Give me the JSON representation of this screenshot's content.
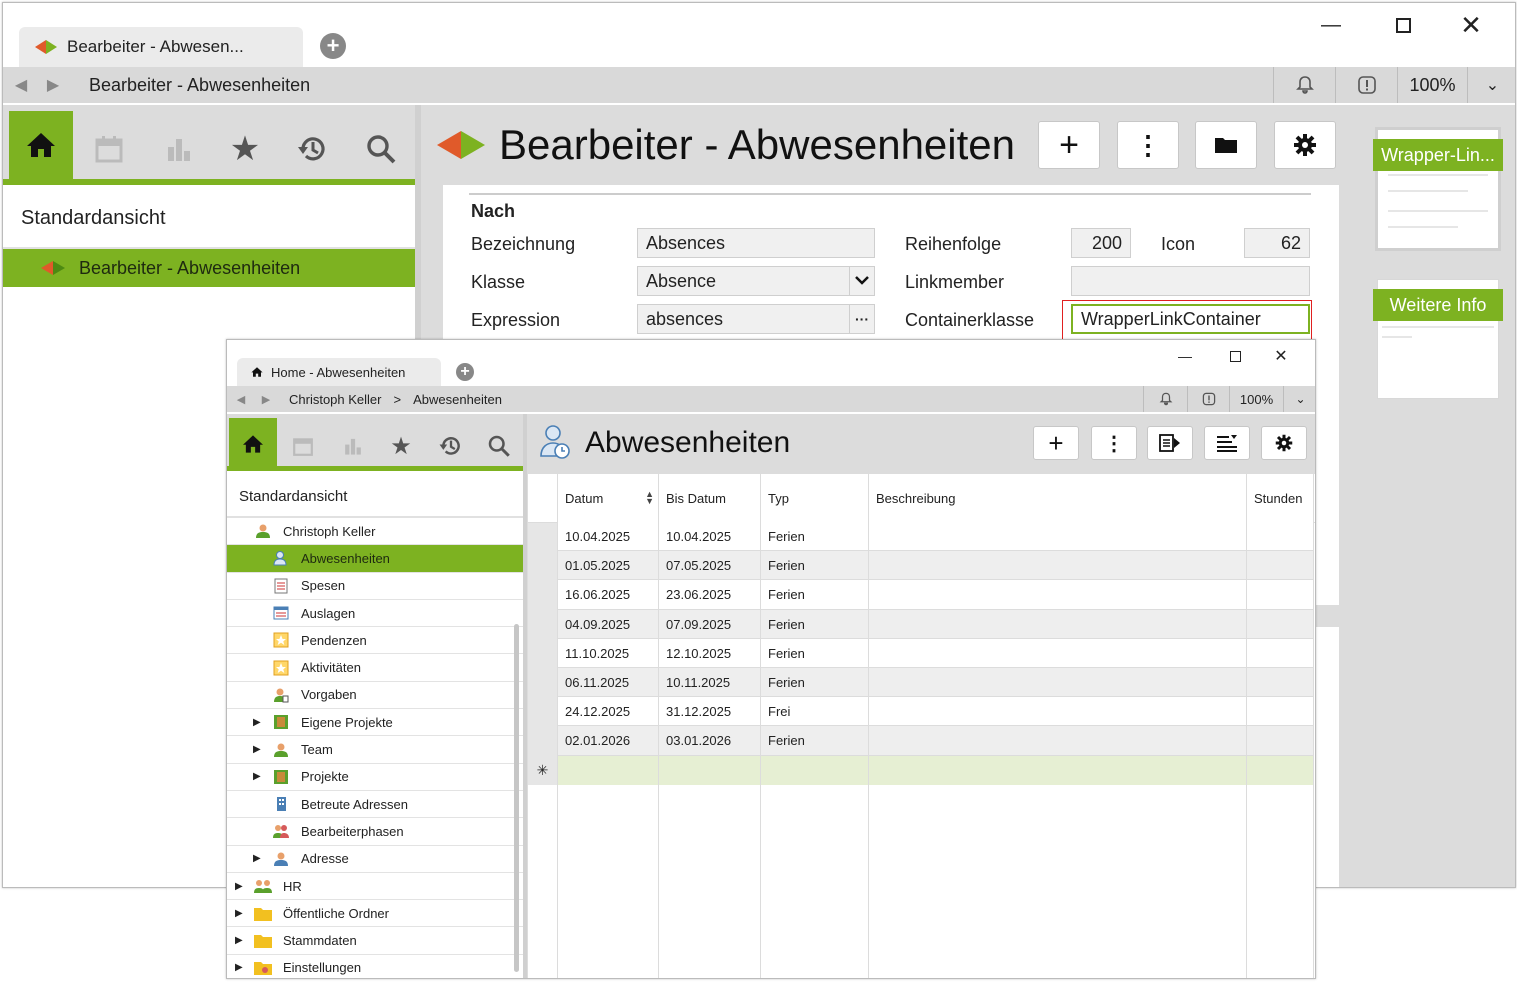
{
  "main": {
    "tab_title": "Bearbeiter - Abwesen...",
    "breadcrumb": "Bearbeiter - Abwesenheiten",
    "zoom": "100%",
    "sidebar": {
      "view_title": "Standardansicht",
      "selected_item": "Bearbeiter - Abwesenheiten"
    },
    "page_title": "Bearbeiter - Abwesenheiten",
    "section_title": "Nach",
    "form": {
      "bezeichnung_label": "Bezeichnung",
      "bezeichnung_value": "Absences",
      "klasse_label": "Klasse",
      "klasse_value": "Absence",
      "expression_label": "Expression",
      "expression_value": "absences",
      "reihenfolge_label": "Reihenfolge",
      "reihenfolge_value": "200",
      "icon_label": "Icon",
      "icon_value": "62",
      "linkmember_label": "Linkmember",
      "linkmember_value": "",
      "containerklasse_label": "Containerklasse",
      "containerklasse_value": "WrapperLinkContainer"
    },
    "thumbnails": [
      "Wrapper-Lin...",
      "Weitere Info"
    ]
  },
  "popup": {
    "tab_title": "Home - Abwesenheiten",
    "breadcrumb_person": "Christoph Keller",
    "breadcrumb_sep": ">",
    "breadcrumb_page": "Abwesenheiten",
    "zoom": "100%",
    "view_title": "Standardansicht",
    "tree": [
      {
        "label": "Christoph Keller",
        "icon": "person-icon"
      },
      {
        "label": "Abwesenheiten",
        "icon": "absence-icon"
      },
      {
        "label": "Spesen",
        "icon": "expense-icon"
      },
      {
        "label": "Auslagen",
        "icon": "outlay-icon"
      },
      {
        "label": "Pendenzen",
        "icon": "pending-icon"
      },
      {
        "label": "Aktivitäten",
        "icon": "activity-icon"
      },
      {
        "label": "Vorgaben",
        "icon": "specification-icon"
      },
      {
        "label": "Eigene Projekte",
        "icon": "project-icon"
      },
      {
        "label": "Team",
        "icon": "team-icon"
      },
      {
        "label": "Projekte",
        "icon": "project-icon"
      },
      {
        "label": "Betreute Adressen",
        "icon": "building-icon"
      },
      {
        "label": "Bearbeiterphasen",
        "icon": "phases-icon"
      },
      {
        "label": "Adresse",
        "icon": "address-icon"
      },
      {
        "label": "HR",
        "icon": "hr-icon"
      },
      {
        "label": "Öffentliche Ordner",
        "icon": "folder-icon"
      },
      {
        "label": "Stammdaten",
        "icon": "folder-icon"
      },
      {
        "label": "Einstellungen",
        "icon": "settings-folder-icon"
      }
    ],
    "page_title": "Abwesenheiten",
    "columns": [
      "Datum",
      "Bis Datum",
      "Typ",
      "Beschreibung",
      "Stunden"
    ],
    "rows": [
      [
        "10.04.2025",
        "10.04.2025",
        "Ferien",
        "",
        ""
      ],
      [
        "01.05.2025",
        "07.05.2025",
        "Ferien",
        "",
        ""
      ],
      [
        "16.06.2025",
        "23.06.2025",
        "Ferien",
        "",
        ""
      ],
      [
        "04.09.2025",
        "07.09.2025",
        "Ferien",
        "",
        ""
      ],
      [
        "11.10.2025",
        "12.10.2025",
        "Ferien",
        "",
        ""
      ],
      [
        "06.11.2025",
        "10.11.2025",
        "Ferien",
        "",
        ""
      ],
      [
        "24.12.2025",
        "31.12.2025",
        "Frei",
        "",
        ""
      ],
      [
        "02.01.2026",
        "03.01.2026",
        "Ferien",
        "",
        ""
      ]
    ],
    "new_row_marker": "✳"
  },
  "colors": {
    "accent": "#7db221",
    "annotation": "#e02020"
  }
}
